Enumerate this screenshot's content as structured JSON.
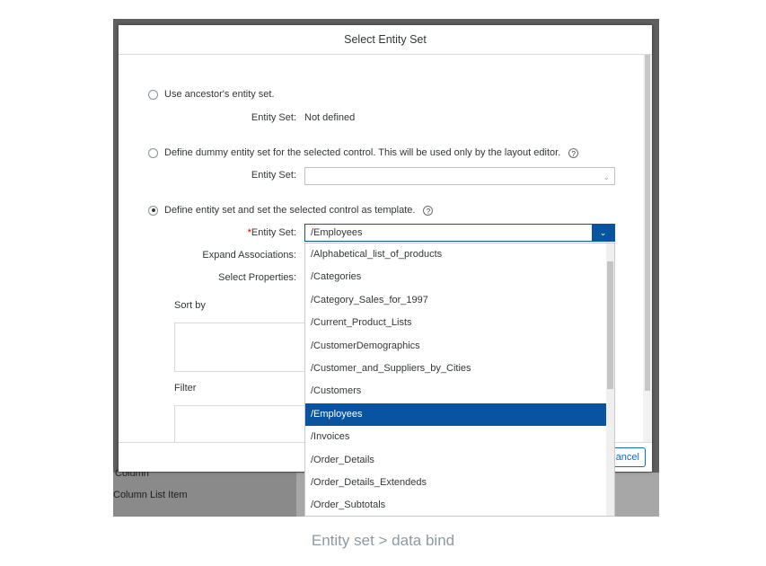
{
  "dialog": {
    "title": "Select Entity Set",
    "cancel_label": "Cancel"
  },
  "options": {
    "ancestor": {
      "label": "Use ancestor's entity set.",
      "entity_set_label": "Entity Set:",
      "entity_set_value": "Not defined",
      "checked": false
    },
    "dummy": {
      "label": "Define dummy entity set for the selected control. This will be used only by the layout editor.",
      "entity_set_label": "Entity Set:",
      "help": "?",
      "checked": false
    },
    "template": {
      "label": "Define entity set and set the selected control as template.",
      "help": "?",
      "checked": true,
      "entity_set_label": "Entity Set:",
      "entity_set_required": "*",
      "entity_set_value": "/Employees",
      "expand_label": "Expand Associations:",
      "select_label": "Select Properties:",
      "sort_label": "Sort by",
      "filter_label": "Filter"
    }
  },
  "dropdown": {
    "items": [
      "/Alphabetical_list_of_products",
      "/Categories",
      "/Category_Sales_for_1997",
      "/Current_Product_Lists",
      "/CustomerDemographics",
      "/Customer_and_Suppliers_by_Cities",
      "/Customers",
      "/Employees",
      "/Invoices",
      "/Order_Details",
      "/Order_Details_Extendeds",
      "/Order_Subtotals"
    ],
    "selected_index": 7
  },
  "background": {
    "column_label": "Column",
    "column_list_item_label": "Column List Item"
  },
  "caption": "Entity set > data bind",
  "colors": {
    "accent": "#0854a0",
    "required": "#bb0000",
    "caption": "#8c9aa3"
  }
}
